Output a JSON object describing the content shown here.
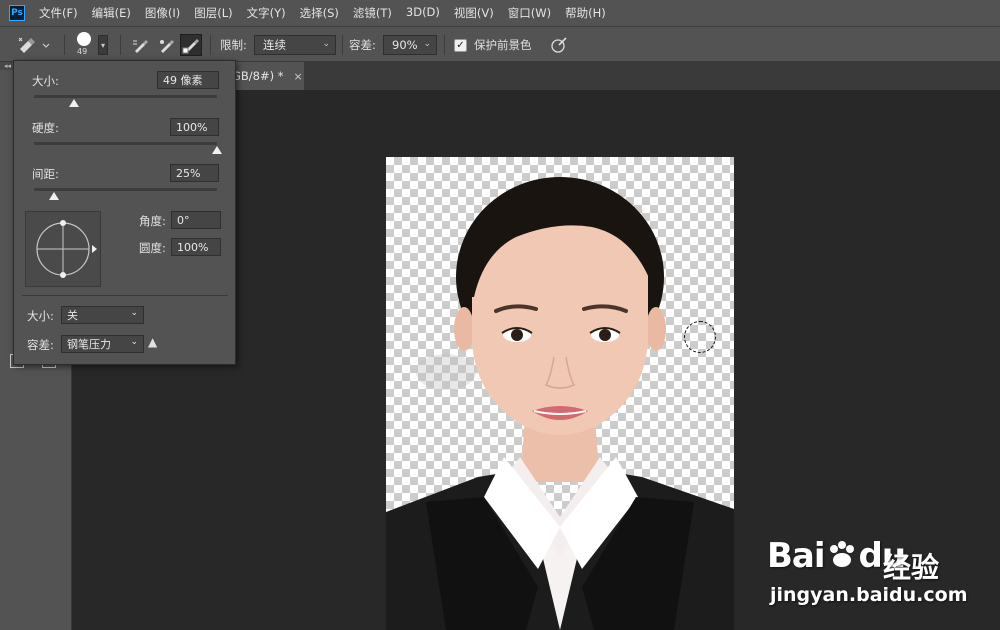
{
  "app": {
    "logo_text": "Ps"
  },
  "menu": [
    "文件(F)",
    "编辑(E)",
    "图像(I)",
    "图层(L)",
    "文字(Y)",
    "选择(S)",
    "滤镜(T)",
    "3D(D)",
    "视图(V)",
    "窗口(W)",
    "帮助(H)"
  ],
  "options_bar": {
    "brush_size": "49",
    "limit_label": "限制:",
    "limit_value": "连续",
    "tolerance_label": "容差:",
    "tolerance_value": "90%",
    "protect_fg_label": "保护前景色",
    "protect_fg_checked": true
  },
  "document_tab": {
    "title": "GB/8#) *",
    "close": "×"
  },
  "brush_panel": {
    "size_label": "大小:",
    "size_value": "49 像素",
    "size_fraction": 0.22,
    "hardness_label": "硬度:",
    "hardness_value": "100%",
    "hardness_fraction": 1.0,
    "spacing_label": "间距:",
    "spacing_value": "25%",
    "spacing_fraction": 0.11,
    "angle_label": "角度:",
    "angle_value": "0°",
    "roundness_label": "圆度:",
    "roundness_value": "100%",
    "size_control_label": "大小:",
    "size_control_value": "关",
    "tolerance_control_label": "容差:",
    "tolerance_control_value": "钢笔压力"
  },
  "watermark": {
    "brand": "Bai",
    "brand2": "du",
    "cn": "经验",
    "url": "jingyan.baidu.com"
  },
  "colors": {
    "ui_dark": "#535353",
    "canvas": "#282828",
    "suit": "#1c1c1c",
    "skin": "#f0c8b4",
    "hair": "#1a1411"
  }
}
